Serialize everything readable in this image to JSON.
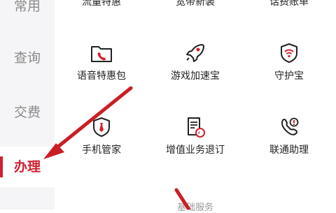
{
  "sidebar": {
    "items": [
      {
        "label": "常用"
      },
      {
        "label": "查询"
      },
      {
        "label": "交费"
      },
      {
        "label": "办理"
      }
    ],
    "active_color": "#d21f2f"
  },
  "grid": {
    "top_row_cut": [
      {
        "label": "流量特惠"
      },
      {
        "label": "宽带新装"
      },
      {
        "label": "话费账单"
      }
    ],
    "row1": [
      {
        "label": "语音特惠包",
        "icon": "folder-phone-icon"
      },
      {
        "label": "游戏加速宝",
        "icon": "rocket-icon"
      },
      {
        "label": "守护宝",
        "icon": "wifi-shield-icon"
      }
    ],
    "row2": [
      {
        "label": "手机管家",
        "icon": "tie-shield-icon"
      },
      {
        "label": "增值业务退订",
        "icon": "document-refresh-icon"
      },
      {
        "label": "联通助理",
        "icon": "phone-alert-icon"
      }
    ]
  },
  "section": {
    "title": "基础服务"
  },
  "annotation": {
    "arrow_color": "#c81f25"
  }
}
